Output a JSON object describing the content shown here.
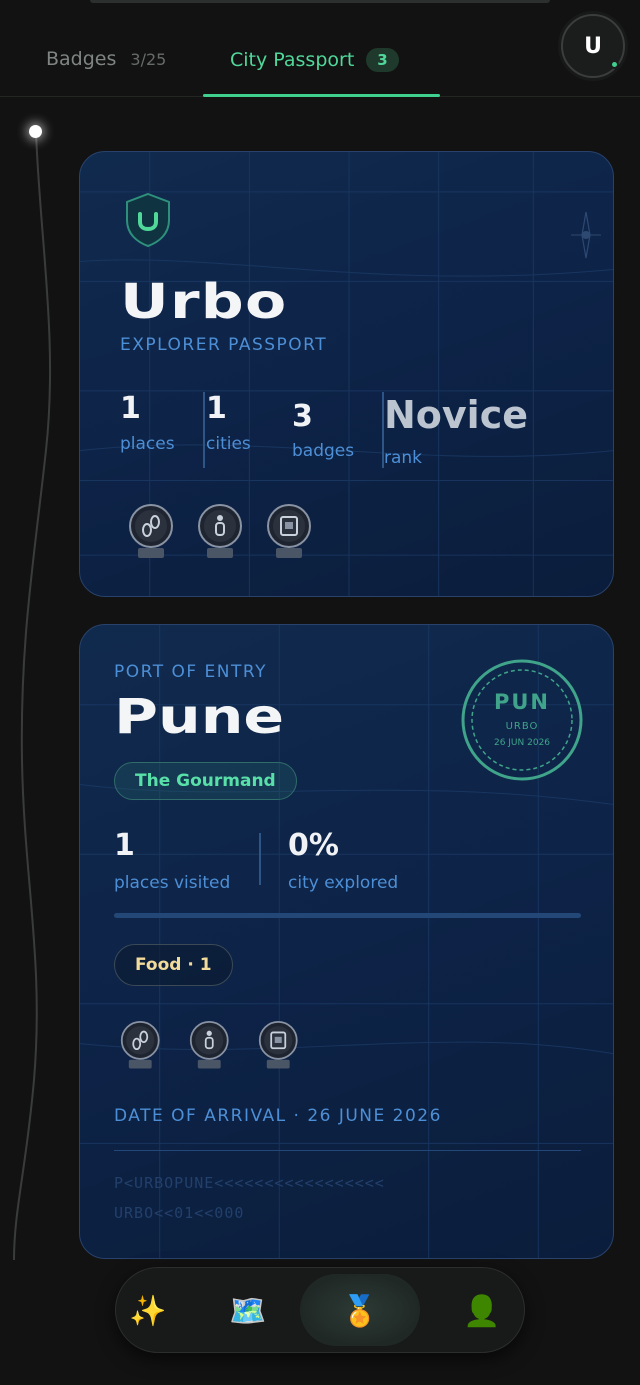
{
  "tabs": [
    {
      "label": "Badges",
      "count": "3/25",
      "active": false
    },
    {
      "label": "City Passport",
      "count": "3",
      "active": true
    }
  ],
  "avatar": {
    "initial": "U",
    "online": true
  },
  "explorer_card": {
    "brand": "Urbo",
    "subtitle": "EXPLORER PASSPORT",
    "stats": [
      {
        "value": "1",
        "label": "places"
      },
      {
        "value": "1",
        "label": "cities"
      },
      {
        "value": "3",
        "label": "badges"
      },
      {
        "value": "Novice",
        "label": "rank"
      }
    ],
    "medal_icons": [
      "footprints-medal-icon",
      "person-medal-icon",
      "map-medal-icon"
    ]
  },
  "city_card": {
    "port_label": "PORT OF ENTRY",
    "city": "Pune",
    "title_pill": "The Gourmand",
    "stamp": {
      "code": "PUN",
      "brand": "URBO",
      "date": "26 JUN 2026"
    },
    "stats": [
      {
        "value": "1",
        "label": "places visited"
      },
      {
        "value": "0%",
        "label": "city explored"
      }
    ],
    "progress_fraction": 0.0,
    "category_pill": "Food · 1",
    "medal_icons": [
      "footprints-medal-icon",
      "person-medal-icon",
      "map-medal-icon"
    ],
    "arrival": "DATE OF ARRIVAL · 26 JUNE 2026",
    "mrz_line1": "P<URBOPUNE<<<<<<<<<<<<<<<<<",
    "mrz_line2": "URBO<<01<<000"
  },
  "nav": [
    {
      "icon": "sparkles-icon",
      "glyph": "✨",
      "active": false
    },
    {
      "icon": "map-icon",
      "glyph": "🗺️",
      "active": false
    },
    {
      "icon": "medal-icon",
      "glyph": "🏅",
      "active": true
    },
    {
      "icon": "profile-icon",
      "glyph": "👤",
      "active": false
    }
  ],
  "colors": {
    "accent": "#3fcf8e",
    "card_bg": "#0d2347",
    "label_blue": "#4d8fd6"
  }
}
